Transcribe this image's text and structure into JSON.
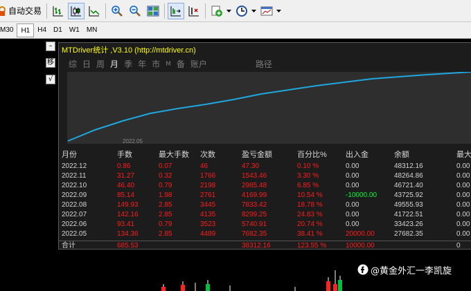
{
  "toolbar": {
    "autotrade_label": "自动交易",
    "icons": [
      "autotrade-icon",
      "bar-chart-icon",
      "candlestick-icon",
      "line-chart-icon",
      "zoom-in-icon",
      "zoom-out-icon",
      "tile-windows-icon",
      "chart-shift-icon",
      "auto-scroll-icon",
      "new-order-icon",
      "periods-icon",
      "templates-icon"
    ]
  },
  "timeframes": {
    "items": [
      "M30",
      "H1",
      "H4",
      "D1",
      "W1",
      "MN"
    ],
    "active": "H1"
  },
  "side_buttons": [
    "–",
    "移",
    "√"
  ],
  "panel": {
    "title": "MTDriver统计 ,V3.10 (http://mtdriver.cn)",
    "tabs": [
      "综",
      "日",
      "周",
      "月",
      "季",
      "年",
      "市",
      "M",
      "备",
      "账户",
      "路径"
    ],
    "active_tab": "月",
    "chart_date_label": "2022.05",
    "columns": [
      "月份",
      "手数",
      "最大手数",
      "次数",
      "盈亏金额",
      "百分比%",
      "出入金",
      "余额",
      "最大"
    ],
    "rows": [
      [
        "2022.12",
        "0.86",
        "0.07",
        "46",
        "47.30",
        "0.10 %",
        "0.00",
        "48312.16",
        "0.00"
      ],
      [
        "2022.11",
        "31.27",
        "0.32",
        "1766",
        "1543.46",
        "3.30 %",
        "0.00",
        "48264.86",
        "0.00"
      ],
      [
        "2022.10",
        "46.40",
        "0.79",
        "2198",
        "2985.48",
        "6.85 %",
        "0.00",
        "46721.40",
        "0.00"
      ],
      [
        "2022.09",
        "85.14",
        "1.98",
        "2761",
        "4169.99",
        "10.54 %",
        "-10000.00",
        "43725.92",
        "0.00"
      ],
      [
        "2022.08",
        "149.93",
        "2.85",
        "3445",
        "7833.42",
        "18.78 %",
        "0.00",
        "49555.93",
        "0.00"
      ],
      [
        "2022.07",
        "142.16",
        "2.85",
        "4135",
        "8299.25",
        "24.83 %",
        "0.00",
        "41722.51",
        "0.00"
      ],
      [
        "2022.06",
        "93.41",
        "0.79",
        "3523",
        "5740.91",
        "20.74 %",
        "0.00",
        "33423.26",
        "0.00"
      ],
      [
        "2022.05",
        "134.36",
        "2.85",
        "4489",
        "7682.35",
        "38.41 %",
        "20000.00",
        "27682.35",
        "0.00"
      ]
    ],
    "total": {
      "label": "合计",
      "lots": "685.53",
      "profit": "38312.16",
      "percent": "123.55 %",
      "deposit": "10000.00",
      "max": "0"
    }
  },
  "watermark": "@黄金外汇一李凯旋",
  "colors": {
    "curve": "#1fa8e0",
    "red": "#ff1c1c",
    "green": "#00ff40",
    "title": "#ffff00"
  }
}
